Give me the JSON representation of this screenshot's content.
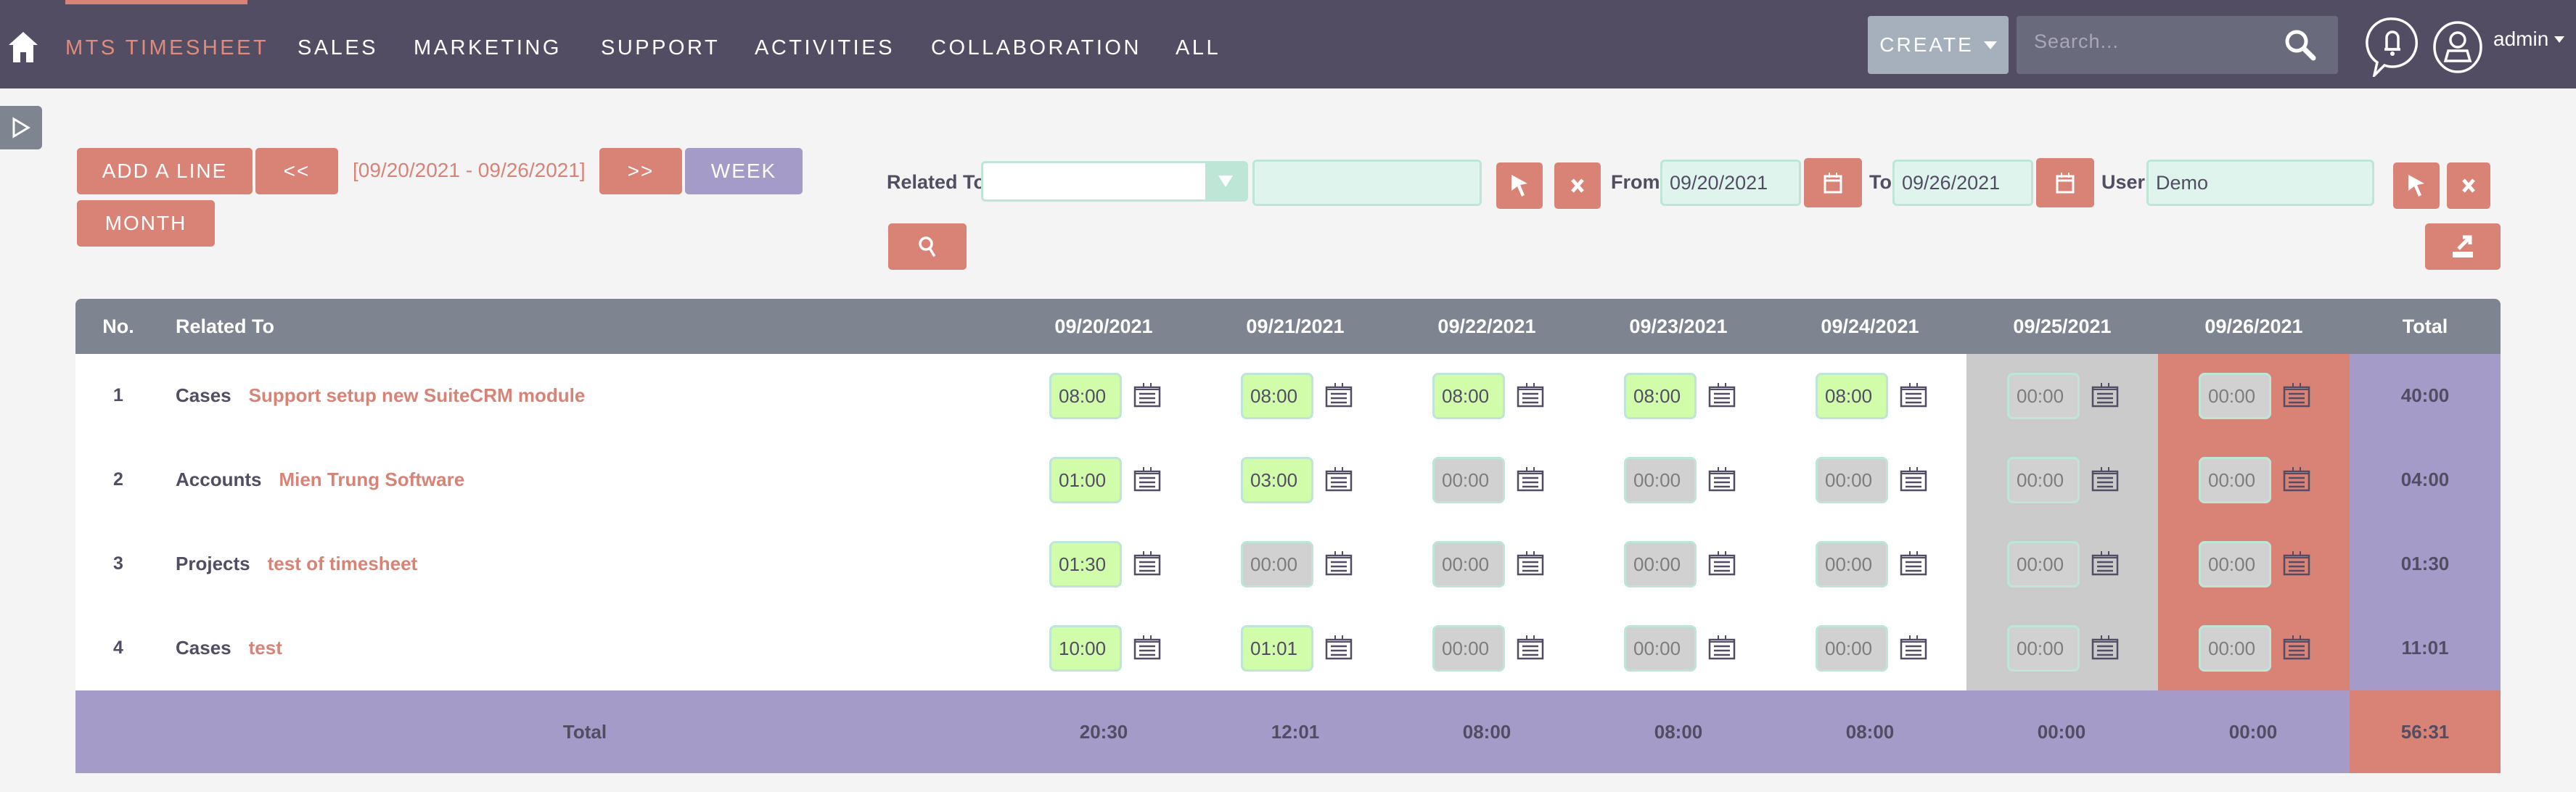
{
  "nav": {
    "items": [
      {
        "label": "MTS TIMESHEET",
        "active": true
      },
      {
        "label": "SALES"
      },
      {
        "label": "MARKETING"
      },
      {
        "label": "SUPPORT"
      },
      {
        "label": "ACTIVITIES"
      },
      {
        "label": "COLLABORATION"
      },
      {
        "label": "ALL"
      }
    ],
    "create_label": "CREATE",
    "search_placeholder": "Search...",
    "user_label": "admin"
  },
  "toolbar": {
    "add_line_label": "ADD A LINE",
    "prev_label": "<<",
    "next_label": ">>",
    "date_range": "[09/20/2021 - 09/26/2021]",
    "week_label": "WEEK",
    "month_label": "MONTH"
  },
  "filters": {
    "related_to_label": "Related To",
    "related_to_type": "",
    "related_to_value": "",
    "from_label": "From",
    "from_value": "09/20/2021",
    "to_label": "To",
    "to_value": "09/26/2021",
    "user_label": "User",
    "user_value": "Demo"
  },
  "table": {
    "headers": {
      "no": "No.",
      "related_to": "Related To",
      "days": [
        "09/20/2021",
        "09/21/2021",
        "09/22/2021",
        "09/23/2021",
        "09/24/2021",
        "09/25/2021",
        "09/26/2021"
      ],
      "total": "Total"
    },
    "rows": [
      {
        "no": "1",
        "type": "Cases",
        "name": "Support setup new SuiteCRM module",
        "hours": [
          "08:00",
          "08:00",
          "08:00",
          "08:00",
          "08:00",
          "00:00",
          "00:00"
        ],
        "total": "40:00"
      },
      {
        "no": "2",
        "type": "Accounts",
        "name": "Mien Trung Software",
        "hours": [
          "01:00",
          "03:00",
          "00:00",
          "00:00",
          "00:00",
          "00:00",
          "00:00"
        ],
        "total": "04:00"
      },
      {
        "no": "3",
        "type": "Projects",
        "name": "test of timesheet",
        "hours": [
          "01:30",
          "00:00",
          "00:00",
          "00:00",
          "00:00",
          "00:00",
          "00:00"
        ],
        "total": "01:30"
      },
      {
        "no": "4",
        "type": "Cases",
        "name": "test",
        "hours": [
          "10:00",
          "01:01",
          "00:00",
          "00:00",
          "00:00",
          "00:00",
          "00:00"
        ],
        "total": "11:01"
      }
    ],
    "footer": {
      "label": "Total",
      "day_totals": [
        "20:30",
        "12:01",
        "08:00",
        "08:00",
        "08:00",
        "00:00",
        "00:00"
      ],
      "grand_total": "56:31"
    }
  },
  "colors": {
    "nav_bg": "#534d64",
    "accent": "#d98276",
    "purple": "#a59bc9",
    "header_gray": "#7e8490",
    "filled_hours": "#d1fdab",
    "empty_hours": "#d1d1d1",
    "weekend_saturday": "#cbcbcb",
    "weekend_sunday": "#d98276"
  }
}
